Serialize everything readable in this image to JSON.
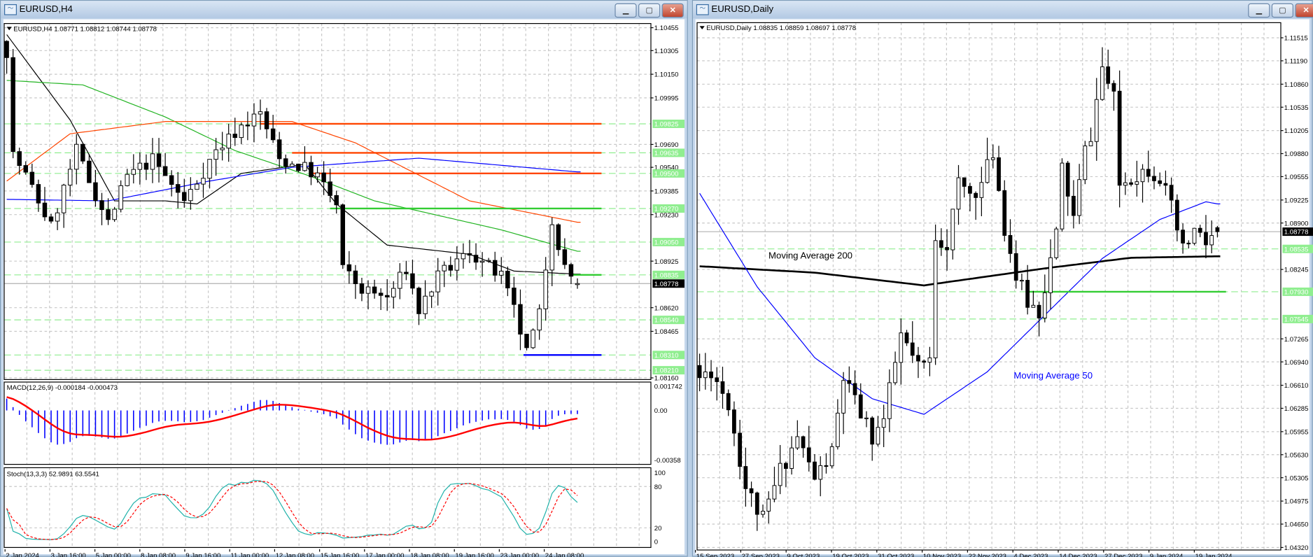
{
  "left_window": {
    "title": "EURUSD,H4",
    "header": {
      "symbol": "EURUSD,H4",
      "ohlc": "1.08771 1.08812 1.08744 1.08778"
    },
    "buttons": {
      "minimize": "▁",
      "maximize": "▢",
      "close": "✕"
    },
    "price_ticks": [
      "1.10455",
      "1.10305",
      "1.10150",
      "1.09995",
      "1.09690",
      "1.09540",
      "1.09385",
      "1.09230",
      "1.08925",
      "1.08620",
      "1.08465",
      "1.08160"
    ],
    "level_labels": [
      "1.09825",
      "1.09635",
      "1.09500",
      "1.09270",
      "1.09050",
      "1.08835",
      "1.08540",
      "1.08310",
      "1.08210"
    ],
    "current_price": "1.08778",
    "time_labels": [
      "2 Jan 2024",
      "3 Jan 16:00",
      "5 Jan 00:00",
      "8 Jan 08:00",
      "9 Jan 16:00",
      "11 Jan 00:00",
      "12 Jan 08:00",
      "15 Jan 16:00",
      "17 Jan 00:00",
      "18 Jan 08:00",
      "19 Jan 16:00",
      "23 Jan 00:00",
      "24 Jan 08:00"
    ],
    "macd": {
      "label": "MACD(12,26,9) -0.000184 -0.000473",
      "ticks": [
        "0.001742",
        "0.00",
        "-0.00358"
      ]
    },
    "stoch": {
      "label": "Stoch(13,3,3) 52.9891 63.5541",
      "ticks": [
        "100",
        "80",
        "20",
        "0"
      ]
    }
  },
  "right_window": {
    "title": "EURUSD,Daily",
    "header": {
      "symbol": "EURUSD,Daily",
      "ohlc": "1.08835 1.08859 1.08697 1.08778"
    },
    "buttons": {
      "minimize": "▁",
      "maximize": "▢",
      "close": "✕"
    },
    "price_ticks": [
      "1.11515",
      "1.11190",
      "1.10860",
      "1.10535",
      "1.10205",
      "1.09880",
      "1.09555",
      "1.09225",
      "1.08900",
      "1.08245",
      "1.07265",
      "1.06940",
      "1.06610",
      "1.06285",
      "1.05955",
      "1.05630",
      "1.05305",
      "1.04975",
      "1.04650",
      "1.04320"
    ],
    "level_labels": [
      "1.08535",
      "1.07930",
      "1.07545"
    ],
    "current_price": "1.08778",
    "time_labels": [
      "15 Sep 2023",
      "27 Sep 2023",
      "9 Oct 2023",
      "19 Oct 2023",
      "31 Oct 2023",
      "10 Nov 2023",
      "22 Nov 2023",
      "4 Dec 2023",
      "14 Dec 2023",
      "27 Dec 2023",
      "9 Jan 2024",
      "19 Jan 2024"
    ],
    "annotations": {
      "ma200": "Moving Average 200",
      "ma50": "Moving Average 50"
    }
  },
  "chart_data": [
    {
      "type": "candlestick",
      "title": "EURUSD,H4",
      "ylim": [
        1.0816,
        1.10455
      ],
      "bars": 91,
      "close_path": [
        [
          0,
          1.10306
        ],
        [
          1,
          1.09624
        ],
        [
          3,
          1.09486
        ],
        [
          7,
          1.09151
        ],
        [
          11,
          1.09646
        ],
        [
          13,
          1.09453
        ],
        [
          16,
          1.09178
        ],
        [
          19,
          1.09481
        ],
        [
          23,
          1.09591
        ],
        [
          28,
          1.09316
        ],
        [
          33,
          1.09646
        ],
        [
          37,
          1.09811
        ],
        [
          40,
          1.09894
        ],
        [
          43,
          1.09591
        ],
        [
          47,
          1.09536
        ],
        [
          49,
          1.09481
        ],
        [
          52,
          1.09288
        ],
        [
          53,
          1.08875
        ],
        [
          56,
          1.08738
        ],
        [
          60,
          1.08683
        ],
        [
          63,
          1.08875
        ],
        [
          65,
          1.086
        ],
        [
          68,
          1.0882
        ],
        [
          73,
          1.08986
        ],
        [
          78,
          1.0882
        ],
        [
          80,
          1.086
        ],
        [
          82,
          1.08325
        ],
        [
          84,
          1.08573
        ],
        [
          86,
          1.09206
        ],
        [
          88,
          1.08875
        ],
        [
          90,
          1.08778
        ]
      ],
      "last_bar": {
        "open": 1.08771,
        "high": 1.08812,
        "low": 1.08744,
        "close": 1.08778
      },
      "moving_averages": [
        {
          "color": "#000000",
          "path": [
            [
              0,
              1.1041
            ],
            [
              10,
              1.0985
            ],
            [
              17,
              1.0932
            ],
            [
              25,
              1.0932
            ],
            [
              30,
              1.093
            ],
            [
              37,
              1.095
            ],
            [
              47,
              1.0956
            ],
            [
              52,
              1.093
            ],
            [
              60,
              1.0903
            ],
            [
              73,
              1.0897
            ],
            [
              80,
              1.0886
            ],
            [
              90,
              1.0884
            ]
          ]
        },
        {
          "color": "#22b422",
          "path": [
            [
              0,
              1.1011
            ],
            [
              12,
              1.1008
            ],
            [
              25,
              1.0987
            ],
            [
              36,
              1.0965
            ],
            [
              48,
              1.0948
            ],
            [
              58,
              1.0932
            ],
            [
              78,
              1.0913
            ],
            [
              90,
              1.0899
            ]
          ]
        },
        {
          "color": "#ff4500",
          "path": [
            [
              0,
              1.0945
            ],
            [
              10,
              1.0976
            ],
            [
              25,
              1.0984
            ],
            [
              45,
              1.0984
            ],
            [
              55,
              1.097
            ],
            [
              73,
              1.0932
            ],
            [
              90,
              1.0918
            ]
          ]
        },
        {
          "color": "#0000ff",
          "path": [
            [
              0,
              1.0933
            ],
            [
              16,
              1.0932
            ],
            [
              32,
              1.0945
            ],
            [
              45,
              1.0954
            ],
            [
              65,
              1.096
            ],
            [
              90,
              1.0951
            ]
          ]
        }
      ],
      "levels": [
        {
          "price": 1.09825,
          "color": "#ff4500",
          "from_bar": 40,
          "to_bar": 93.8
        },
        {
          "price": 1.09635,
          "color": "#ff4500",
          "from_bar": 45,
          "to_bar": 93.8
        },
        {
          "price": 1.095,
          "color": "#ff4500",
          "from_bar": 48,
          "to_bar": 93.8
        },
        {
          "price": 1.0927,
          "color": "#32cd32",
          "from_bar": 51,
          "to_bar": 93.8
        },
        {
          "price": 1.08835,
          "color": "#32cd32",
          "from_bar": 89,
          "to_bar": 93.8
        },
        {
          "price": 1.0831,
          "color": "#0000ff",
          "from_bar": 81.5,
          "to_bar": 93.8
        }
      ],
      "macd": {
        "fast": 12,
        "slow": 26,
        "signal": 9,
        "ylim": [
          -0.00358,
          0.001742
        ]
      },
      "stoch": {
        "k": 13,
        "d": 3,
        "slowing": 3,
        "ylim": [
          0,
          100
        ]
      }
    },
    {
      "type": "candlestick",
      "title": "EURUSD,Daily",
      "ylim": [
        1.0432,
        1.11515
      ],
      "bars": 91,
      "close_path": [
        [
          0,
          1.06714
        ],
        [
          2,
          1.06833
        ],
        [
          5,
          1.06358
        ],
        [
          8,
          1.05173
        ],
        [
          11,
          1.04699
        ],
        [
          14,
          1.0541
        ],
        [
          17,
          1.05884
        ],
        [
          20,
          1.05292
        ],
        [
          23,
          1.05647
        ],
        [
          25,
          1.06714
        ],
        [
          27,
          1.06358
        ],
        [
          30,
          1.05884
        ],
        [
          32,
          1.06122
        ],
        [
          35,
          1.07307
        ],
        [
          38,
          1.06833
        ],
        [
          40,
          1.06951
        ],
        [
          41,
          1.08729
        ],
        [
          43,
          1.08611
        ],
        [
          45,
          1.09441
        ],
        [
          47,
          1.09322
        ],
        [
          49,
          1.09441
        ],
        [
          51,
          1.09915
        ],
        [
          53,
          1.08848
        ],
        [
          55,
          1.08137
        ],
        [
          57,
          1.07781
        ],
        [
          59,
          1.07662
        ],
        [
          62,
          1.08729
        ],
        [
          63,
          1.09678
        ],
        [
          65,
          1.08967
        ],
        [
          67,
          1.09915
        ],
        [
          68,
          1.10152
        ],
        [
          70,
          1.111
        ],
        [
          72,
          1.10626
        ],
        [
          73,
          1.09441
        ],
        [
          75,
          1.09559
        ],
        [
          78,
          1.09678
        ],
        [
          80,
          1.09559
        ],
        [
          82,
          1.09085
        ],
        [
          84,
          1.08492
        ],
        [
          86,
          1.08789
        ],
        [
          88,
          1.08611
        ],
        [
          90,
          1.08778
        ]
      ],
      "last_bar": {
        "open": 1.08835,
        "high": 1.08859,
        "low": 1.08697,
        "close": 1.08778
      },
      "moving_averages": [
        {
          "name": "Moving Average 200",
          "color": "#000000",
          "path": [
            [
              0,
              1.0829
            ],
            [
              20,
              1.082
            ],
            [
              39,
              1.0802
            ],
            [
              60,
              1.0826
            ],
            [
              75,
              1.0841
            ],
            [
              90,
              1.0843
            ]
          ]
        },
        {
          "name": "Moving Average 50",
          "color": "#0000ff",
          "path": [
            [
              0,
              1.0932
            ],
            [
              10,
              1.08
            ],
            [
              20,
              1.07
            ],
            [
              30,
              1.0642
            ],
            [
              39,
              1.062
            ],
            [
              50,
              1.068
            ],
            [
              60,
              1.076
            ],
            [
              70,
              1.084
            ],
            [
              80,
              1.0895
            ],
            [
              88,
              1.092
            ],
            [
              90,
              1.0917
            ]
          ]
        }
      ],
      "levels": [
        {
          "price": 1.0793,
          "color": "#32cd32",
          "from_bar": 57,
          "to_bar": 91.5
        }
      ]
    }
  ]
}
